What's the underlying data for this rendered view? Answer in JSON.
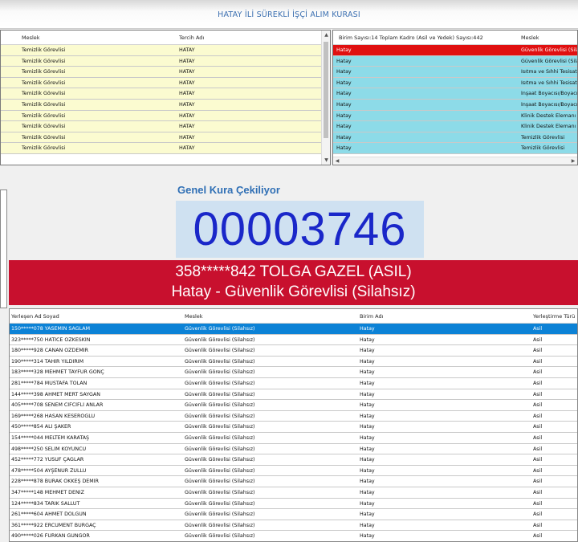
{
  "app": {
    "title": "HATAY İLİ SÜREKLİ İŞÇİ ALIM KURASI"
  },
  "top_left": {
    "columns": [
      "Meslek",
      "Tercih Adı"
    ],
    "rows": [
      [
        "Temizlik Görevlisi",
        "HATAY"
      ],
      [
        "Temizlik Görevlisi",
        "HATAY"
      ],
      [
        "Temizlik Görevlisi",
        "HATAY"
      ],
      [
        "Temizlik Görevlisi",
        "HATAY"
      ],
      [
        "Temizlik Görevlisi",
        "HATAY"
      ],
      [
        "Temizlik Görevlisi",
        "HATAY"
      ],
      [
        "Temizlik Görevlisi",
        "HATAY"
      ],
      [
        "Temizlik Görevlisi",
        "HATAY"
      ],
      [
        "Temizlik Görevlisi",
        "HATAY"
      ],
      [
        "Temizlik Görevlisi",
        "HATAY"
      ]
    ]
  },
  "top_right": {
    "columns": [
      "Birim Sayısı:14 Toplam Kadro (Asil ve Yedek) Sayısı:442",
      "Meslek"
    ],
    "rows": [
      [
        "Hatay",
        "Güvenlik Görevlisi (Silahsız)"
      ],
      [
        "Hatay",
        "Güvenlik Görevlisi (Silahsız)"
      ],
      [
        "Hatay",
        "Isıtma ve Sıhhi Tesisatçı"
      ],
      [
        "Hatay",
        "Isıtma ve Sıhhi Tesisatçı"
      ],
      [
        "Hatay",
        "İnşaat Boyacısı/Boyacı"
      ],
      [
        "Hatay",
        "İnşaat Boyacısı/Boyacı"
      ],
      [
        "Hatay",
        "Klinik Destek Elemanı (Hasta)"
      ],
      [
        "Hatay",
        "Klinik Destek Elemanı (Hasta)"
      ],
      [
        "Hatay",
        "Temizlik Görevlisi"
      ],
      [
        "Hatay",
        "Temizlik Görevlisi"
      ]
    ]
  },
  "draw": {
    "label": "Genel Kura Çekiliyor",
    "number": "00003746",
    "result_line1": "358*****842 TOLGA GAZEL (ASIL)",
    "result_line2": "Hatay - Güvenlik Görevlisi (Silahsız)"
  },
  "bottom": {
    "columns": [
      "Yerleşen Ad Soyad",
      "Meslek",
      "Birim Adı",
      "Yerleştirme Türü"
    ],
    "rows": [
      [
        "150*****078 YASEMİN SAĞLAM",
        "Güvenlik Görevlisi (Silahsız)",
        "Hatay",
        "Asil"
      ],
      [
        "323*****750 HATİCE ÖZKESKİN",
        "Güvenlik Görevlisi (Silahsız)",
        "Hatay",
        "Asil"
      ],
      [
        "180*****928 CANAN ÖZDEMİR",
        "Güvenlik Görevlisi (Silahsız)",
        "Hatay",
        "Asil"
      ],
      [
        "190*****314 TAHİR YILDIRIM",
        "Güvenlik Görevlisi (Silahsız)",
        "Hatay",
        "Asil"
      ],
      [
        "183*****328 MEHMET TAYFUR GÖNÇ",
        "Güvenlik Görevlisi (Silahsız)",
        "Hatay",
        "Asil"
      ],
      [
        "281*****784 MUSTAFA TOLAN",
        "Güvenlik Görevlisi (Silahsız)",
        "Hatay",
        "Asil"
      ],
      [
        "144*****398 AHMET MERT SAYGAN",
        "Güvenlik Görevlisi (Silahsız)",
        "Hatay",
        "Asil"
      ],
      [
        "405*****708 SENEM CİFCİFLİ ANLAR",
        "Güvenlik Görevlisi (Silahsız)",
        "Hatay",
        "Asil"
      ],
      [
        "169*****268 HASAN KESEROĞLU",
        "Güvenlik Görevlisi (Silahsız)",
        "Hatay",
        "Asil"
      ],
      [
        "450*****854 ALİ ŞAKER",
        "Güvenlik Görevlisi (Silahsız)",
        "Hatay",
        "Asil"
      ],
      [
        "154*****044 MELTEM KARATAŞ",
        "Güvenlik Görevlisi (Silahsız)",
        "Hatay",
        "Asil"
      ],
      [
        "498*****250 SELİM KOYUNCU",
        "Güvenlik Görevlisi (Silahsız)",
        "Hatay",
        "Asil"
      ],
      [
        "452*****772 YUSUF ÇAĞLAR",
        "Güvenlik Görevlisi (Silahsız)",
        "Hatay",
        "Asil"
      ],
      [
        "478*****504 AYŞENUR ZULLU",
        "Güvenlik Görevlisi (Silahsız)",
        "Hatay",
        "Asil"
      ],
      [
        "228*****878 BURAK ÖKKEŞ DEMİR",
        "Güvenlik Görevlisi (Silahsız)",
        "Hatay",
        "Asil"
      ],
      [
        "347*****148 MEHMET DENİZ",
        "Güvenlik Görevlisi (Silahsız)",
        "Hatay",
        "Asil"
      ],
      [
        "124*****834 TARIK SALLUT",
        "Güvenlik Görevlisi (Silahsız)",
        "Hatay",
        "Asil"
      ],
      [
        "261*****604 AHMET DOLĞUN",
        "Güvenlik Görevlisi (Silahsız)",
        "Hatay",
        "Asil"
      ],
      [
        "361*****922 ERCÜMENT BURGAÇ",
        "Güvenlik Görevlisi (Silahsız)",
        "Hatay",
        "Asil"
      ],
      [
        "490*****026 FURKAN GÜNGÖR",
        "Güvenlik Görevlisi (Silahsız)",
        "Hatay",
        "Asil"
      ]
    ]
  },
  "icons": {
    "scroll_up": "▲",
    "scroll_down": "▼",
    "scroll_left": "◀",
    "scroll_right": "▶"
  },
  "colors": {
    "top_left_row": "#fbfbd0",
    "top_right_row": "#8ddbe8",
    "top_right_selected": "#e01010",
    "banner": "#c8102e",
    "counter_text": "#1a27c9",
    "bottom_selected": "#0c82d6"
  }
}
